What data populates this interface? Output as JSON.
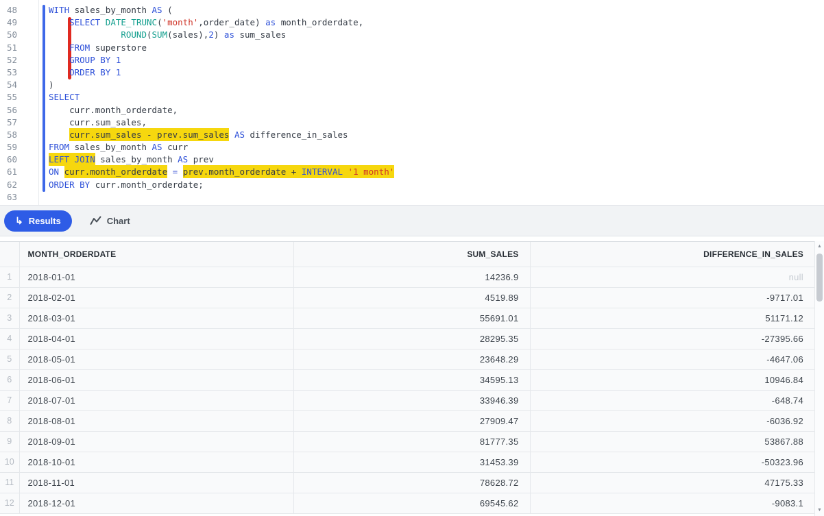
{
  "editor": {
    "lines": [
      {
        "n": 48,
        "tokens": [
          [
            "kw",
            "WITH"
          ],
          [
            "pl",
            " sales_by_month "
          ],
          [
            "kw",
            "AS"
          ],
          [
            "pl",
            " ("
          ]
        ]
      },
      {
        "n": 49,
        "tokens": [
          [
            "pl",
            "    "
          ],
          [
            "kw",
            "SELECT"
          ],
          [
            "pl",
            " "
          ],
          [
            "fn",
            "DATE_TRUNC"
          ],
          [
            "pl",
            "("
          ],
          [
            "str",
            "'month'"
          ],
          [
            "pl",
            ",order_date) "
          ],
          [
            "kw",
            "as"
          ],
          [
            "pl",
            " month_orderdate,"
          ]
        ]
      },
      {
        "n": 50,
        "tokens": [
          [
            "pl",
            "              "
          ],
          [
            "fn",
            "ROUND"
          ],
          [
            "pl",
            "("
          ],
          [
            "fn",
            "SUM"
          ],
          [
            "pl",
            "(sales),"
          ],
          [
            "num",
            "2"
          ],
          [
            "pl",
            ") "
          ],
          [
            "kw",
            "as"
          ],
          [
            "pl",
            " sum_sales"
          ]
        ]
      },
      {
        "n": 51,
        "tokens": [
          [
            "pl",
            "    "
          ],
          [
            "kw",
            "FROM"
          ],
          [
            "pl",
            " superstore"
          ]
        ]
      },
      {
        "n": 52,
        "tokens": [
          [
            "pl",
            "    "
          ],
          [
            "kw",
            "GROUP BY"
          ],
          [
            "pl",
            " "
          ],
          [
            "num",
            "1"
          ]
        ]
      },
      {
        "n": 53,
        "tokens": [
          [
            "pl",
            "    "
          ],
          [
            "kw",
            "ORDER BY"
          ],
          [
            "pl",
            " "
          ],
          [
            "num",
            "1"
          ]
        ]
      },
      {
        "n": 54,
        "tokens": [
          [
            "pl",
            ")"
          ]
        ]
      },
      {
        "n": 55,
        "tokens": [
          [
            "kw",
            "SELECT"
          ]
        ]
      },
      {
        "n": 56,
        "tokens": [
          [
            "pl",
            "    curr.month_orderdate,"
          ]
        ]
      },
      {
        "n": 57,
        "tokens": [
          [
            "pl",
            "    curr.sum_sales,"
          ]
        ]
      },
      {
        "n": 58,
        "tokens": [
          [
            "pl",
            "    "
          ],
          [
            "pl hl",
            "curr.sum_sales - prev.sum_sales"
          ],
          [
            "pl",
            " "
          ],
          [
            "kw",
            "AS"
          ],
          [
            "pl",
            " difference_in_sales"
          ]
        ]
      },
      {
        "n": 59,
        "tokens": [
          [
            "kw",
            "FROM"
          ],
          [
            "pl",
            " sales_by_month "
          ],
          [
            "kw",
            "AS"
          ],
          [
            "pl",
            " curr"
          ]
        ]
      },
      {
        "n": 60,
        "tokens": [
          [
            "kw hl",
            "LEFT JOIN"
          ],
          [
            "pl",
            " sales_by_month "
          ],
          [
            "kw",
            "AS"
          ],
          [
            "pl",
            " prev"
          ]
        ]
      },
      {
        "n": 61,
        "tokens": [
          [
            "kw",
            "ON"
          ],
          [
            "pl",
            " "
          ],
          [
            "pl hl",
            "curr.month_orderdate"
          ],
          [
            "pl",
            " "
          ],
          [
            "op",
            "="
          ],
          [
            "pl",
            " "
          ],
          [
            "pl hl",
            "prev.month_orderdate + "
          ],
          [
            "kw hl",
            "INTERVAL"
          ],
          [
            "pl hl",
            " "
          ],
          [
            "str hl",
            "'1 month'"
          ]
        ]
      },
      {
        "n": 62,
        "tokens": [
          [
            "kw",
            "ORDER BY"
          ],
          [
            "pl",
            " curr.month_orderdate;"
          ]
        ]
      },
      {
        "n": 63,
        "tokens": []
      }
    ]
  },
  "tabs": {
    "results_icon": "↳",
    "results_label": "Results",
    "chart_label": "Chart"
  },
  "results_table": {
    "columns": [
      {
        "label": "MONTH_ORDERDATE",
        "align": "left"
      },
      {
        "label": "SUM_SALES",
        "align": "right"
      },
      {
        "label": "DIFFERENCE_IN_SALES",
        "align": "right"
      }
    ],
    "rows": [
      {
        "n": 1,
        "cells": [
          "2018-01-01",
          "14236.9",
          "null"
        ]
      },
      {
        "n": 2,
        "cells": [
          "2018-02-01",
          "4519.89",
          "-9717.01"
        ]
      },
      {
        "n": 3,
        "cells": [
          "2018-03-01",
          "55691.01",
          "51171.12"
        ]
      },
      {
        "n": 4,
        "cells": [
          "2018-04-01",
          "28295.35",
          "-27395.66"
        ]
      },
      {
        "n": 5,
        "cells": [
          "2018-05-01",
          "23648.29",
          "-4647.06"
        ]
      },
      {
        "n": 6,
        "cells": [
          "2018-06-01",
          "34595.13",
          "10946.84"
        ]
      },
      {
        "n": 7,
        "cells": [
          "2018-07-01",
          "33946.39",
          "-648.74"
        ]
      },
      {
        "n": 8,
        "cells": [
          "2018-08-01",
          "27909.47",
          "-6036.92"
        ]
      },
      {
        "n": 9,
        "cells": [
          "2018-09-01",
          "81777.35",
          "53867.88"
        ]
      },
      {
        "n": 10,
        "cells": [
          "2018-10-01",
          "31453.39",
          "-50323.96"
        ]
      },
      {
        "n": 11,
        "cells": [
          "2018-11-01",
          "78628.72",
          "47175.33"
        ]
      },
      {
        "n": 12,
        "cells": [
          "2018-12-01",
          "69545.62",
          "-9083.1"
        ]
      }
    ]
  },
  "colors": {
    "accent_blue": "#2e5ce6",
    "keyword_blue": "#2c4fd8",
    "function_teal": "#0f9d8c",
    "string_red": "#cf3428",
    "highlight_yellow": "#f6d70e",
    "query_indicator_blue": "#3e68e8",
    "block_indicator_red": "#e02a21",
    "toolbar_gray": "#f1f3f5"
  },
  "icons": {
    "results": "return-arrow-icon",
    "chart": "line-chart-icon",
    "scroll_up": "▲",
    "scroll_down": "▼"
  }
}
